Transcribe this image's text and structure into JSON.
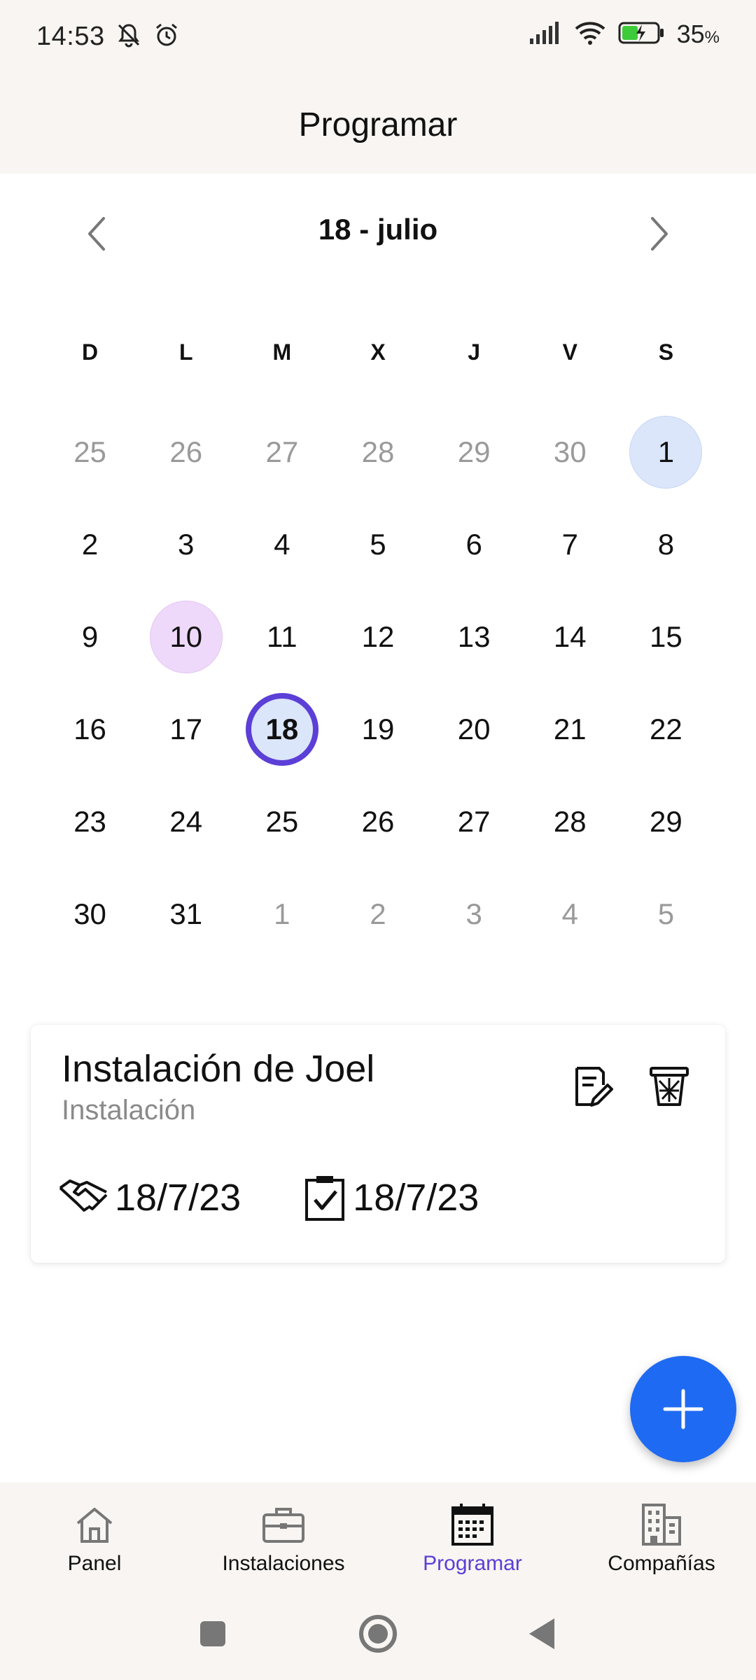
{
  "status_bar": {
    "time": "14:53",
    "battery_value": "35",
    "battery_unit": "%"
  },
  "header": {
    "title": "Programar"
  },
  "calendar": {
    "month_label": "18 - julio",
    "weekdays": [
      "D",
      "L",
      "M",
      "X",
      "J",
      "V",
      "S"
    ],
    "days": [
      {
        "n": "25",
        "muted": true
      },
      {
        "n": "26",
        "muted": true
      },
      {
        "n": "27",
        "muted": true
      },
      {
        "n": "28",
        "muted": true
      },
      {
        "n": "29",
        "muted": true
      },
      {
        "n": "30",
        "muted": true
      },
      {
        "n": "1",
        "hl": "blue"
      },
      {
        "n": "2"
      },
      {
        "n": "3"
      },
      {
        "n": "4"
      },
      {
        "n": "5"
      },
      {
        "n": "6"
      },
      {
        "n": "7"
      },
      {
        "n": "8"
      },
      {
        "n": "9"
      },
      {
        "n": "10",
        "hl": "purple"
      },
      {
        "n": "11"
      },
      {
        "n": "12"
      },
      {
        "n": "13"
      },
      {
        "n": "14"
      },
      {
        "n": "15"
      },
      {
        "n": "16"
      },
      {
        "n": "17"
      },
      {
        "n": "18",
        "selected": true
      },
      {
        "n": "19"
      },
      {
        "n": "20"
      },
      {
        "n": "21"
      },
      {
        "n": "22"
      },
      {
        "n": "23"
      },
      {
        "n": "24"
      },
      {
        "n": "25"
      },
      {
        "n": "26"
      },
      {
        "n": "27"
      },
      {
        "n": "28"
      },
      {
        "n": "29"
      },
      {
        "n": "30"
      },
      {
        "n": "31"
      },
      {
        "n": "1",
        "muted": true
      },
      {
        "n": "2",
        "muted": true
      },
      {
        "n": "3",
        "muted": true
      },
      {
        "n": "4",
        "muted": true
      },
      {
        "n": "5",
        "muted": true
      }
    ]
  },
  "event_card": {
    "title": "Instalación de Joel",
    "subtitle": "Instalación",
    "start_date": "18/7/23",
    "end_date": "18/7/23",
    "actions": [
      "edit-note-icon",
      "trash-icon"
    ]
  },
  "bottom_nav": {
    "items": [
      {
        "label": "Panel",
        "icon": "home-icon",
        "active": false
      },
      {
        "label": "Instalaciones",
        "icon": "briefcase-icon",
        "active": false
      },
      {
        "label": "Programar",
        "icon": "calendar-icon",
        "active": true
      },
      {
        "label": "Compañías",
        "icon": "buildings-icon",
        "active": false
      }
    ]
  },
  "colors": {
    "accent": "#5b3fd6",
    "fab": "#1f6af2",
    "highlight_blue": "#dbe6fb",
    "highlight_purple": "#efd9fa",
    "surface": "#f8f5f2"
  }
}
